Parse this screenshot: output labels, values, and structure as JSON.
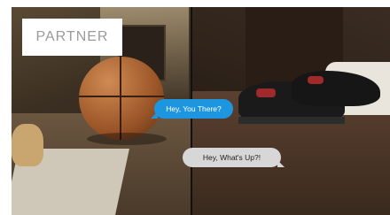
{
  "badge": {
    "label": "PARTNER"
  },
  "messages": [
    {
      "text": "Hey, You There?",
      "color": "#1e96df"
    },
    {
      "text": "Hey, What's Up?!",
      "color": "#d7d7d7"
    }
  ],
  "scene": {
    "left_photo": "basketball-on-floor",
    "right_photo": "sneakers-on-floor"
  }
}
